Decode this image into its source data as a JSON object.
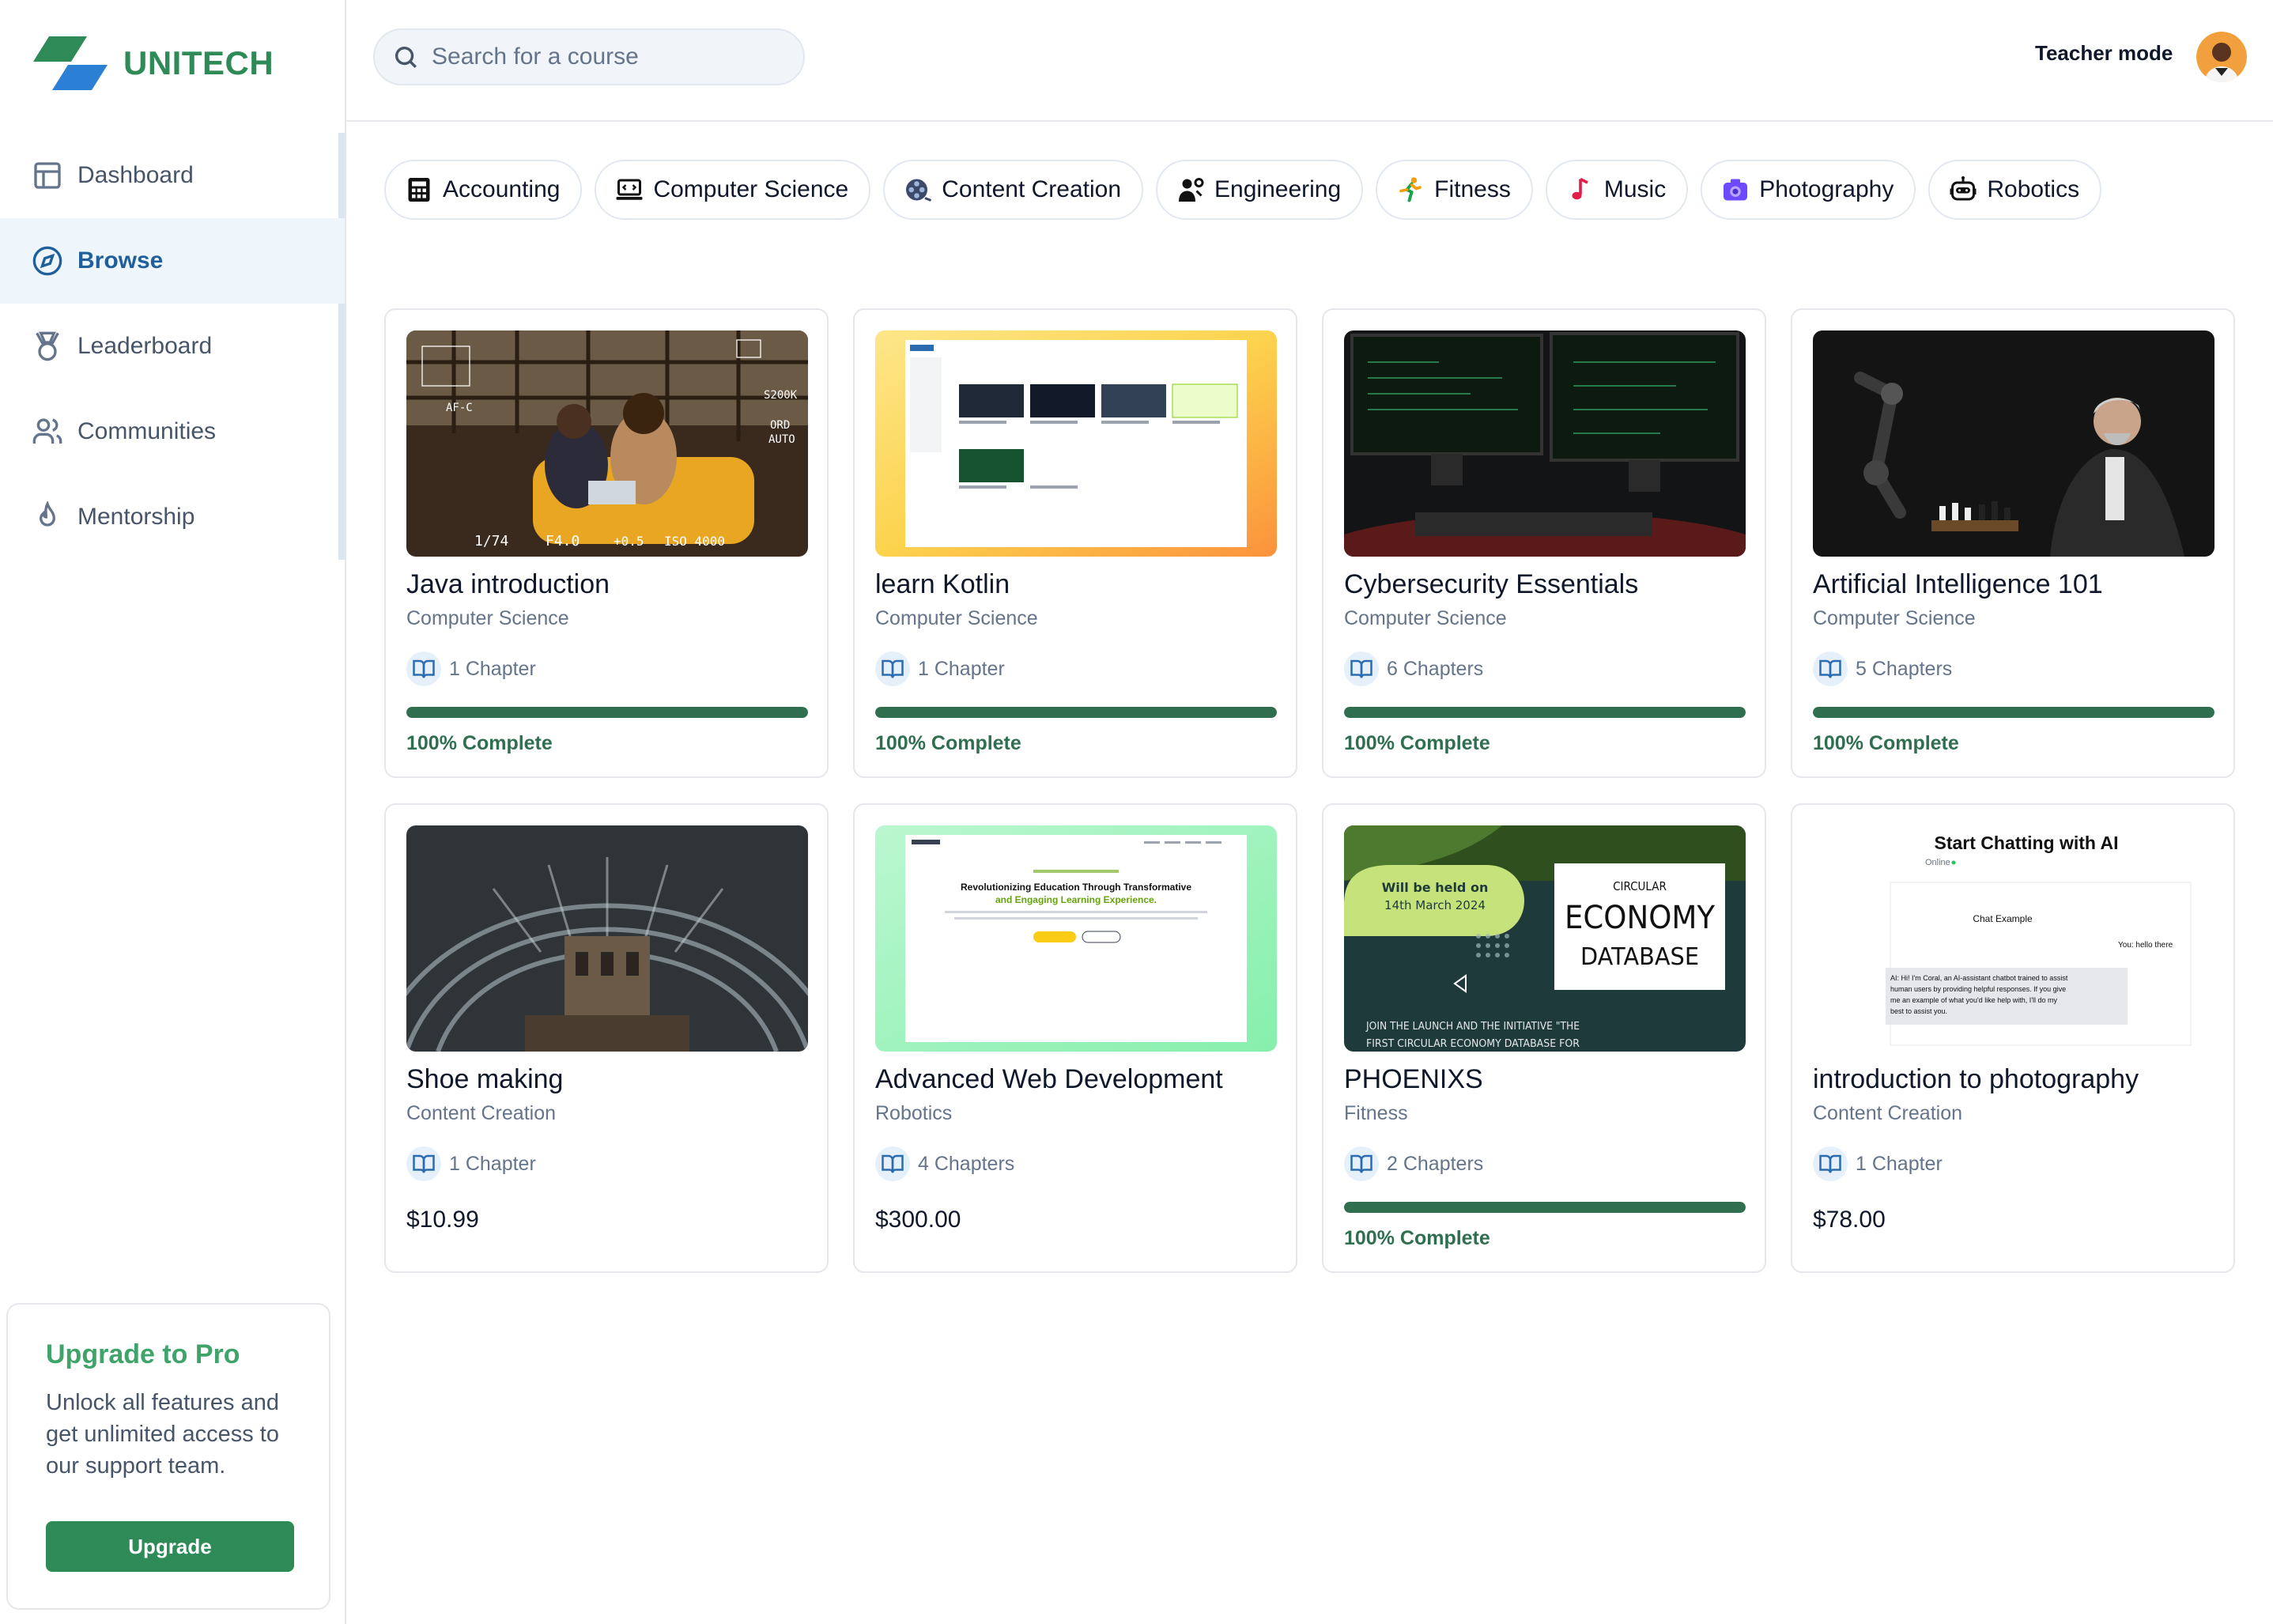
{
  "brand": {
    "name": "UNITECH",
    "primary_color": "#2e8b57",
    "secondary_color": "#2b6cb0"
  },
  "sidebar": {
    "items": [
      {
        "label": "Dashboard",
        "icon": "layout-icon",
        "active": false
      },
      {
        "label": "Browse",
        "icon": "compass-icon",
        "active": true
      },
      {
        "label": "Leaderboard",
        "icon": "medal-icon",
        "active": false
      },
      {
        "label": "Communities",
        "icon": "users-icon",
        "active": false
      },
      {
        "label": "Mentorship",
        "icon": "flame-icon",
        "active": false
      }
    ],
    "upgrade": {
      "title": "Upgrade to Pro",
      "description": "Unlock all features and get unlimited access to our support team.",
      "button": "Upgrade"
    }
  },
  "header": {
    "search_placeholder": "Search for a course",
    "mode_label": "Teacher mode"
  },
  "categories": [
    {
      "label": "Accounting",
      "icon": "calculator-icon"
    },
    {
      "label": "Computer Science",
      "icon": "computer-icon"
    },
    {
      "label": "Content Creation",
      "icon": "film-reel-icon"
    },
    {
      "label": "Engineering",
      "icon": "engineer-icon"
    },
    {
      "label": "Fitness",
      "icon": "runner-icon"
    },
    {
      "label": "Music",
      "icon": "music-note-icon"
    },
    {
      "label": "Photography",
      "icon": "camera-icon"
    },
    {
      "label": "Robotics",
      "icon": "robot-icon"
    }
  ],
  "courses": [
    {
      "title": "Java introduction",
      "category": "Computer Science",
      "chapters": "1 Chapter",
      "progress": 100,
      "progress_label": "100% Complete"
    },
    {
      "title": "learn Kotlin",
      "category": "Computer Science",
      "chapters": "1 Chapter",
      "progress": 100,
      "progress_label": "100% Complete"
    },
    {
      "title": "Cybersecurity Essentials",
      "category": "Computer Science",
      "chapters": "6 Chapters",
      "progress": 100,
      "progress_label": "100% Complete"
    },
    {
      "title": "Artificial Intelligence 101",
      "category": "Computer Science",
      "chapters": "5 Chapters",
      "progress": 100,
      "progress_label": "100% Complete"
    },
    {
      "title": "Shoe making",
      "category": "Content Creation",
      "chapters": "1 Chapter",
      "price": "$10.99"
    },
    {
      "title": "Advanced Web Development",
      "category": "Robotics",
      "chapters": "4 Chapters",
      "price": "$300.00"
    },
    {
      "title": "PHOENIXS",
      "category": "Fitness",
      "chapters": "2 Chapters",
      "progress": 100,
      "progress_label": "100% Complete"
    },
    {
      "title": "introduction to photography",
      "category": "Content Creation",
      "chapters": "1 Chapter",
      "price": "$78.00"
    }
  ],
  "thumbnails": {
    "java_overlay": [
      "AF-C",
      "S200K",
      "ORD",
      "AUTO",
      "1/74",
      "F4.0",
      "+0.5",
      "ISO 4000"
    ],
    "webdev": {
      "headline_1": "Revolutionizing Education Through Transformative",
      "headline_2": "and Engaging Learning Experience."
    },
    "phoenixs": {
      "event_line_1": "Will be held on",
      "event_line_2": "14th March 2024",
      "box_1": "CIRCULAR",
      "box_2": "ECONOMY",
      "box_3": "DATABASE",
      "footer_1": "JOIN THE LAUNCH AND THE INITIATIVE \"THE",
      "footer_2": "FIRST CIRCULAR ECONOMY DATABASE FOR"
    },
    "chat": {
      "title": "Start Chatting with AI",
      "status": "Online",
      "panel_title": "Chat Example",
      "user_msg": "You: hello there",
      "ai_msg_1": "AI: Hi! I'm Coral, an AI-assistant chatbot trained to assist",
      "ai_msg_2": "human users by providing helpful responses. If you give",
      "ai_msg_3": "me an example of what you'd like help with, I'll do my",
      "ai_msg_4": "best to assist you."
    }
  }
}
